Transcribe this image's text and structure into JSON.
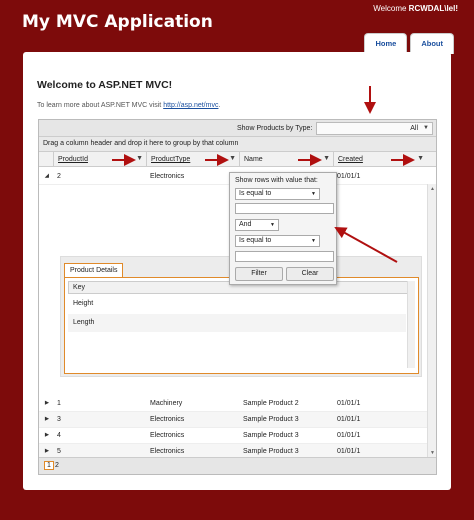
{
  "app": {
    "title": "My MVC Application",
    "welcome_prefix": "Welcome",
    "user": "RCWDAL\\lel!"
  },
  "nav": {
    "home": "Home",
    "about": "About"
  },
  "page": {
    "heading": "Welcome to ASP.NET MVC!",
    "intro_text": "To learn more about ASP.NET MVC visit",
    "intro_link": "http://asp.net/mvc",
    "intro_end": "."
  },
  "toolbar": {
    "label": "Show Products by Type:",
    "selected": "All"
  },
  "group_panel": "Drag a column header and drop it here to group by that column",
  "columns": [
    "ProductId",
    "ProductType",
    "Name",
    "Created"
  ],
  "rows": [
    {
      "id": "2",
      "type": "Electronics",
      "name": "",
      "created": "01/01/1"
    },
    {
      "id": "1",
      "type": "Machinery",
      "name": "Sample Product 2",
      "created": "01/01/1"
    },
    {
      "id": "3",
      "type": "Electronics",
      "name": "Sample Product 3",
      "created": "01/01/1"
    },
    {
      "id": "4",
      "type": "Electronics",
      "name": "Sample Product 3",
      "created": "01/01/1"
    },
    {
      "id": "5",
      "type": "Electronics",
      "name": "Sample Product 3",
      "created": "01/01/1"
    }
  ],
  "detail": {
    "tab": "Product Details",
    "key_header": "Key",
    "items": [
      "Height",
      "Length"
    ]
  },
  "filter": {
    "title": "Show rows with value that:",
    "op1": "Is equal to",
    "logic": "And",
    "op2": "Is equal to",
    "filter_btn": "Filter",
    "clear_btn": "Clear"
  },
  "pager": {
    "pages": [
      "1",
      "2"
    ],
    "current": "1"
  },
  "colors": {
    "background": "#7d0b0b",
    "accent": "#e08a2a",
    "link": "#1a4f9e",
    "annotation_arrow": "#b01010"
  }
}
